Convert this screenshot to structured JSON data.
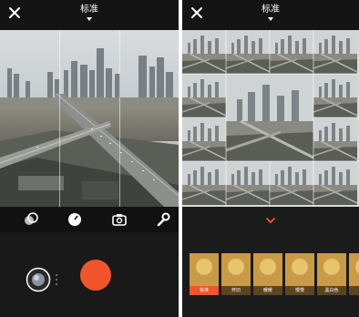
{
  "left_panel": {
    "close_icon": "close-icon",
    "title": "标准",
    "tools": [
      "layers-icon",
      "settings-dial-icon",
      "switch-camera-icon",
      "wrench-icon"
    ],
    "gallery_icon": "gallery-icon",
    "shutter_icon": "shutter-button"
  },
  "right_panel": {
    "close_icon": "close-icon",
    "title": "标准",
    "collapse_icon": "chevron-down-icon",
    "filters": [
      {
        "label": "标准",
        "active": true
      },
      {
        "label": "怀旧",
        "active": false
      },
      {
        "label": "暖暖",
        "active": false
      },
      {
        "label": "慢慢",
        "active": false
      },
      {
        "label": "黑白色",
        "active": false
      },
      {
        "label": "",
        "active": false
      }
    ]
  },
  "colors": {
    "accent": "#f2552c",
    "top_bar": "#141414",
    "background": "#1b1b1b"
  }
}
